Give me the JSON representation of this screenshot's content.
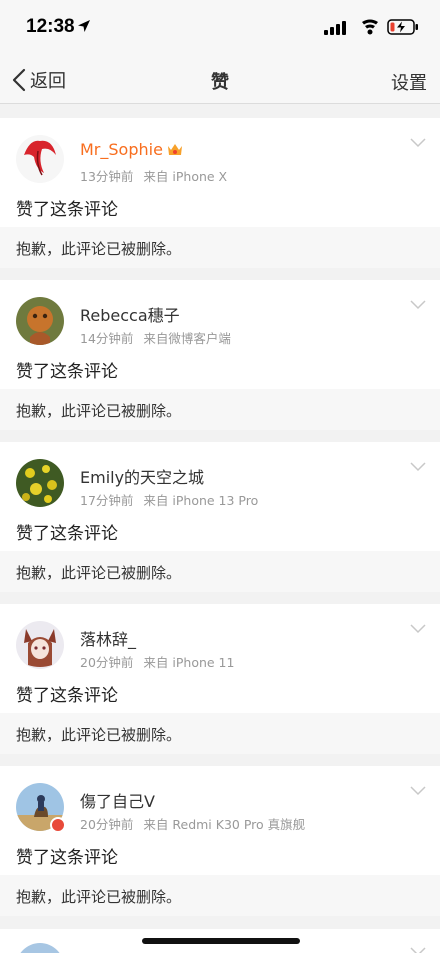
{
  "status_bar": {
    "time": "12:38"
  },
  "nav": {
    "back_label": "返回",
    "title": "赞",
    "settings_label": "设置"
  },
  "cards": [
    {
      "username": "Mr_Sophie",
      "time": "13分钟前",
      "source": "来自 iPhone X",
      "action": "赞了这条评论",
      "quote": "抱歉，此评论已被删除。"
    },
    {
      "username": "Rebecca穗子",
      "time": "14分钟前",
      "source": "来自微博客户端",
      "action": "赞了这条评论",
      "quote": "抱歉，此评论已被删除。"
    },
    {
      "username": "Emily的天空之城",
      "time": "17分钟前",
      "source": "来自 iPhone 13 Pro",
      "action": "赞了这条评论",
      "quote": "抱歉，此评论已被删除。"
    },
    {
      "username": "落林辞_",
      "time": "20分钟前",
      "source": "来自 iPhone 11",
      "action": "赞了这条评论",
      "quote": "抱歉，此评论已被删除。"
    },
    {
      "username": "傷了自己V",
      "time": "20分钟前",
      "source": "来自 Redmi K30 Pro 真旗舰",
      "action": "赞了这条评论",
      "quote": "抱歉，此评论已被删除。"
    }
  ],
  "colors": {
    "vip_name": "#f86e1f",
    "meta_gray": "#999999",
    "battery_low": "#e8402f"
  },
  "icons": [
    "location-arrow-icon",
    "signal-icon",
    "wifi-icon",
    "battery-icon",
    "back-chevron-icon",
    "crown-icon",
    "chevron-down-icon"
  ]
}
